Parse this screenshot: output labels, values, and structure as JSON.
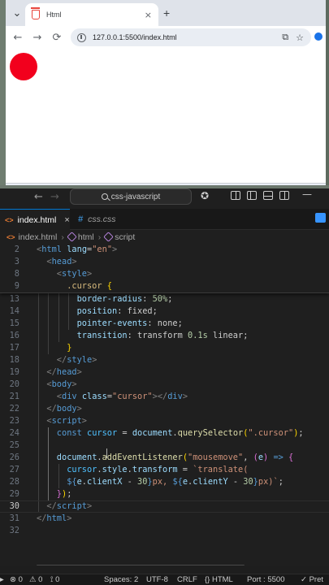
{
  "browser": {
    "tab_title": "Html",
    "tab_close": "×",
    "new_tab": "+",
    "url": "127.0.0.1:5500/index.html",
    "back": "←",
    "forward": "→",
    "reload": "⟳",
    "translate": "⧉",
    "bookmark": "☆",
    "page": {
      "cursor_color": "#f2001d"
    }
  },
  "vscode": {
    "nav_back": "←",
    "nav_forward": "→",
    "command_center": "css-javascript",
    "copilot": "✪",
    "minimize": "—",
    "tabs": [
      {
        "label": "index.html",
        "close": "×"
      },
      {
        "label": "css.css"
      }
    ],
    "breadcrumbs": {
      "file": "index.html",
      "node1": "html",
      "node2": "script"
    }
  },
  "code": {
    "current_line": 30,
    "sticky_lines": [
      {
        "n": "2",
        "indent": 0,
        "tokens": [
          [
            "t-bracket",
            "<"
          ],
          [
            "t-tag",
            "html"
          ],
          [
            "t-plain",
            " "
          ],
          [
            "t-attr",
            "lang"
          ],
          [
            "t-plain",
            "="
          ],
          [
            "t-str",
            "\"en\""
          ],
          [
            "t-bracket",
            ">"
          ]
        ]
      },
      {
        "n": "3",
        "indent": 1,
        "tokens": [
          [
            "t-bracket",
            "<"
          ],
          [
            "t-tag",
            "head"
          ],
          [
            "t-bracket",
            ">"
          ]
        ]
      },
      {
        "n": "8",
        "indent": 2,
        "tokens": [
          [
            "t-bracket",
            "<"
          ],
          [
            "t-tag",
            "style"
          ],
          [
            "t-bracket",
            ">"
          ]
        ]
      },
      {
        "n": "9",
        "indent": 3,
        "tokens": [
          [
            "t-sel",
            ".cursor"
          ],
          [
            "t-plain",
            " "
          ],
          [
            "t-brace1",
            "{"
          ]
        ]
      }
    ],
    "lines": [
      {
        "n": "13",
        "indent": 4,
        "tokens": [
          [
            "t-prop",
            "border-radius"
          ],
          [
            "t-plain",
            ": "
          ],
          [
            "t-num",
            "50%"
          ],
          [
            "t-plain",
            ";"
          ]
        ]
      },
      {
        "n": "14",
        "indent": 4,
        "tokens": [
          [
            "t-prop",
            "position"
          ],
          [
            "t-plain",
            ": "
          ],
          [
            "t-plain",
            "fixed"
          ],
          [
            "t-plain",
            ";"
          ]
        ]
      },
      {
        "n": "15",
        "indent": 4,
        "tokens": [
          [
            "t-prop",
            "pointer-events"
          ],
          [
            "t-plain",
            ": "
          ],
          [
            "t-plain",
            "none"
          ],
          [
            "t-plain",
            ";"
          ]
        ]
      },
      {
        "n": "16",
        "indent": 4,
        "tokens": [
          [
            "t-prop",
            "transition"
          ],
          [
            "t-plain",
            ": "
          ],
          [
            "t-plain",
            "transform "
          ],
          [
            "t-num",
            "0.1s"
          ],
          [
            "t-plain",
            " linear;"
          ]
        ]
      },
      {
        "n": "17",
        "indent": 3,
        "tokens": [
          [
            "t-brace1",
            "}"
          ]
        ]
      },
      {
        "n": "18",
        "indent": 2,
        "tokens": [
          [
            "t-bracket",
            "</"
          ],
          [
            "t-tag",
            "style"
          ],
          [
            "t-bracket",
            ">"
          ]
        ]
      },
      {
        "n": "19",
        "indent": 1,
        "tokens": [
          [
            "t-bracket",
            "</"
          ],
          [
            "t-tag",
            "head"
          ],
          [
            "t-bracket",
            ">"
          ]
        ]
      },
      {
        "n": "20",
        "indent": 1,
        "tokens": [
          [
            "t-bracket",
            "<"
          ],
          [
            "t-tag",
            "body"
          ],
          [
            "t-bracket",
            ">"
          ]
        ]
      },
      {
        "n": "21",
        "indent": 2,
        "tokens": [
          [
            "t-bracket",
            "<"
          ],
          [
            "t-tag",
            "div"
          ],
          [
            "t-plain",
            " "
          ],
          [
            "t-attr",
            "class"
          ],
          [
            "t-plain",
            "="
          ],
          [
            "t-str",
            "\"cursor\""
          ],
          [
            "t-bracket",
            "></"
          ],
          [
            "t-tag",
            "div"
          ],
          [
            "t-bracket",
            ">"
          ]
        ]
      },
      {
        "n": "22",
        "indent": 1,
        "tokens": [
          [
            "t-bracket",
            "</"
          ],
          [
            "t-tag",
            "body"
          ],
          [
            "t-bracket",
            ">"
          ]
        ]
      },
      {
        "n": "23",
        "indent": 1,
        "tokens": [
          [
            "t-bracket",
            "<"
          ],
          [
            "t-tag",
            "script"
          ],
          [
            "t-bracket",
            ">"
          ]
        ]
      },
      {
        "n": "24",
        "indent": 2,
        "tokens": [
          [
            "t-kw",
            "const"
          ],
          [
            "t-plain",
            " "
          ],
          [
            "t-var",
            "cursor"
          ],
          [
            "t-plain",
            " = "
          ],
          [
            "t-attr",
            "document"
          ],
          [
            "t-plain",
            "."
          ],
          [
            "t-fn",
            "querySelector"
          ],
          [
            "t-brace1",
            "("
          ],
          [
            "t-str",
            "\".cursor\""
          ],
          [
            "t-brace1",
            ")"
          ],
          [
            "t-plain",
            ";"
          ]
        ]
      },
      {
        "n": "25",
        "indent": 0,
        "tokens": []
      },
      {
        "n": "26",
        "indent": 2,
        "tokens": [
          [
            "t-attr",
            "document"
          ],
          [
            "t-plain",
            "."
          ],
          [
            "t-fn",
            "addEventListener"
          ],
          [
            "t-brace1",
            "("
          ],
          [
            "t-str",
            "\"mousemove\""
          ],
          [
            "t-plain",
            ", "
          ],
          [
            "t-brace2",
            "("
          ],
          [
            "t-attr",
            "e"
          ],
          [
            "t-brace2",
            ")"
          ],
          [
            "t-plain",
            " "
          ],
          [
            "t-kw",
            "=>"
          ],
          [
            "t-plain",
            " "
          ],
          [
            "t-brace2",
            "{"
          ]
        ]
      },
      {
        "n": "27",
        "indent": 3,
        "tokens": [
          [
            "t-var",
            "cursor"
          ],
          [
            "t-plain",
            "."
          ],
          [
            "t-attr",
            "style"
          ],
          [
            "t-plain",
            "."
          ],
          [
            "t-attr",
            "transform"
          ],
          [
            "t-plain",
            " = "
          ],
          [
            "t-str",
            "`translate("
          ]
        ]
      },
      {
        "n": "28",
        "indent": 3,
        "tokens": [
          [
            "t-tpl",
            "${"
          ],
          [
            "t-attr",
            "e"
          ],
          [
            "t-plain",
            "."
          ],
          [
            "t-attr",
            "clientX"
          ],
          [
            "t-plain",
            " - "
          ],
          [
            "t-num",
            "30"
          ],
          [
            "t-tpl",
            "}"
          ],
          [
            "t-str",
            "px, "
          ],
          [
            "t-tpl",
            "${"
          ],
          [
            "t-attr",
            "e"
          ],
          [
            "t-plain",
            "."
          ],
          [
            "t-attr",
            "clientY"
          ],
          [
            "t-plain",
            " - "
          ],
          [
            "t-num",
            "30"
          ],
          [
            "t-tpl",
            "}"
          ],
          [
            "t-str",
            "px)`"
          ],
          [
            "t-plain",
            ";"
          ]
        ]
      },
      {
        "n": "29",
        "indent": 2,
        "tokens": [
          [
            "t-brace2",
            "}"
          ],
          [
            "t-brace1",
            ")"
          ],
          [
            "t-plain",
            ";"
          ]
        ]
      },
      {
        "n": "30",
        "indent": 1,
        "tokens": [
          [
            "t-bracket",
            "</"
          ],
          [
            "t-tag",
            "script"
          ],
          [
            "t-bracket",
            ">"
          ]
        ]
      },
      {
        "n": "31",
        "indent": 0,
        "tokens": [
          [
            "t-bracket",
            "</"
          ],
          [
            "t-tag",
            "html"
          ],
          [
            "t-bracket",
            ">"
          ]
        ]
      },
      {
        "n": "32",
        "indent": 0,
        "tokens": []
      }
    ]
  },
  "statusbar": {
    "errors": "⊗ 0",
    "warnings": "⚠ 0",
    "ports": "⟟ 0",
    "spaces": "Spaces: 2",
    "encoding": "UTF-8",
    "eol": "CRLF",
    "language": "{} HTML",
    "port": "Port : 5500",
    "prettier": "✓ Pret"
  },
  "colors": {
    "accent": "#0078d4",
    "cursor_red": "#f2001d",
    "editor_bg": "#1f1f1f"
  }
}
